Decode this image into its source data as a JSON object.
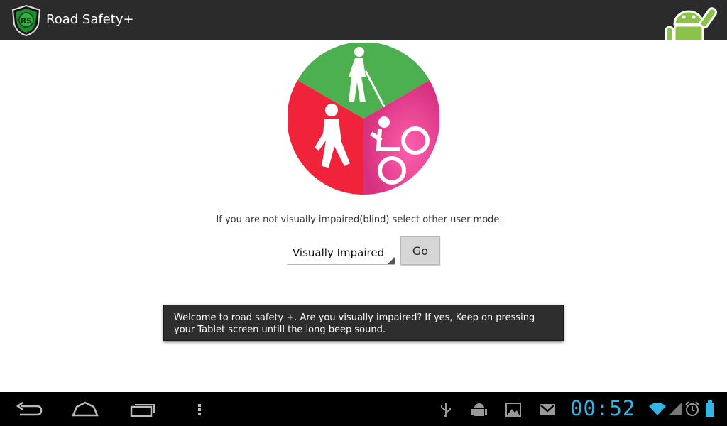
{
  "app": {
    "title": "Road Safety+",
    "icon": "shield-logo-icon"
  },
  "content": {
    "hint_text": "If you are not visually impaired(blind) select other user mode.",
    "mode_spinner": {
      "selected": "Visually Impaired"
    },
    "go_button": "Go"
  },
  "toast": {
    "message": "Welcome to road safety +. Are you visually impaired? If yes, Keep on pressing your Tablet screen untill the long beep sound."
  },
  "status_bar": {
    "time": "00:52",
    "icons": [
      "usb-icon",
      "android-debug-icon",
      "gallery-icon",
      "gmail-icon",
      "wifi-icon",
      "signal-icon",
      "alarm-icon",
      "battery-icon"
    ]
  },
  "colors": {
    "action_bar": "#2b2b2b",
    "wheel_green": "#4caf50",
    "wheel_red": "#f0233a",
    "wheel_pink": "#e8449a",
    "clock": "#33b5e5"
  }
}
